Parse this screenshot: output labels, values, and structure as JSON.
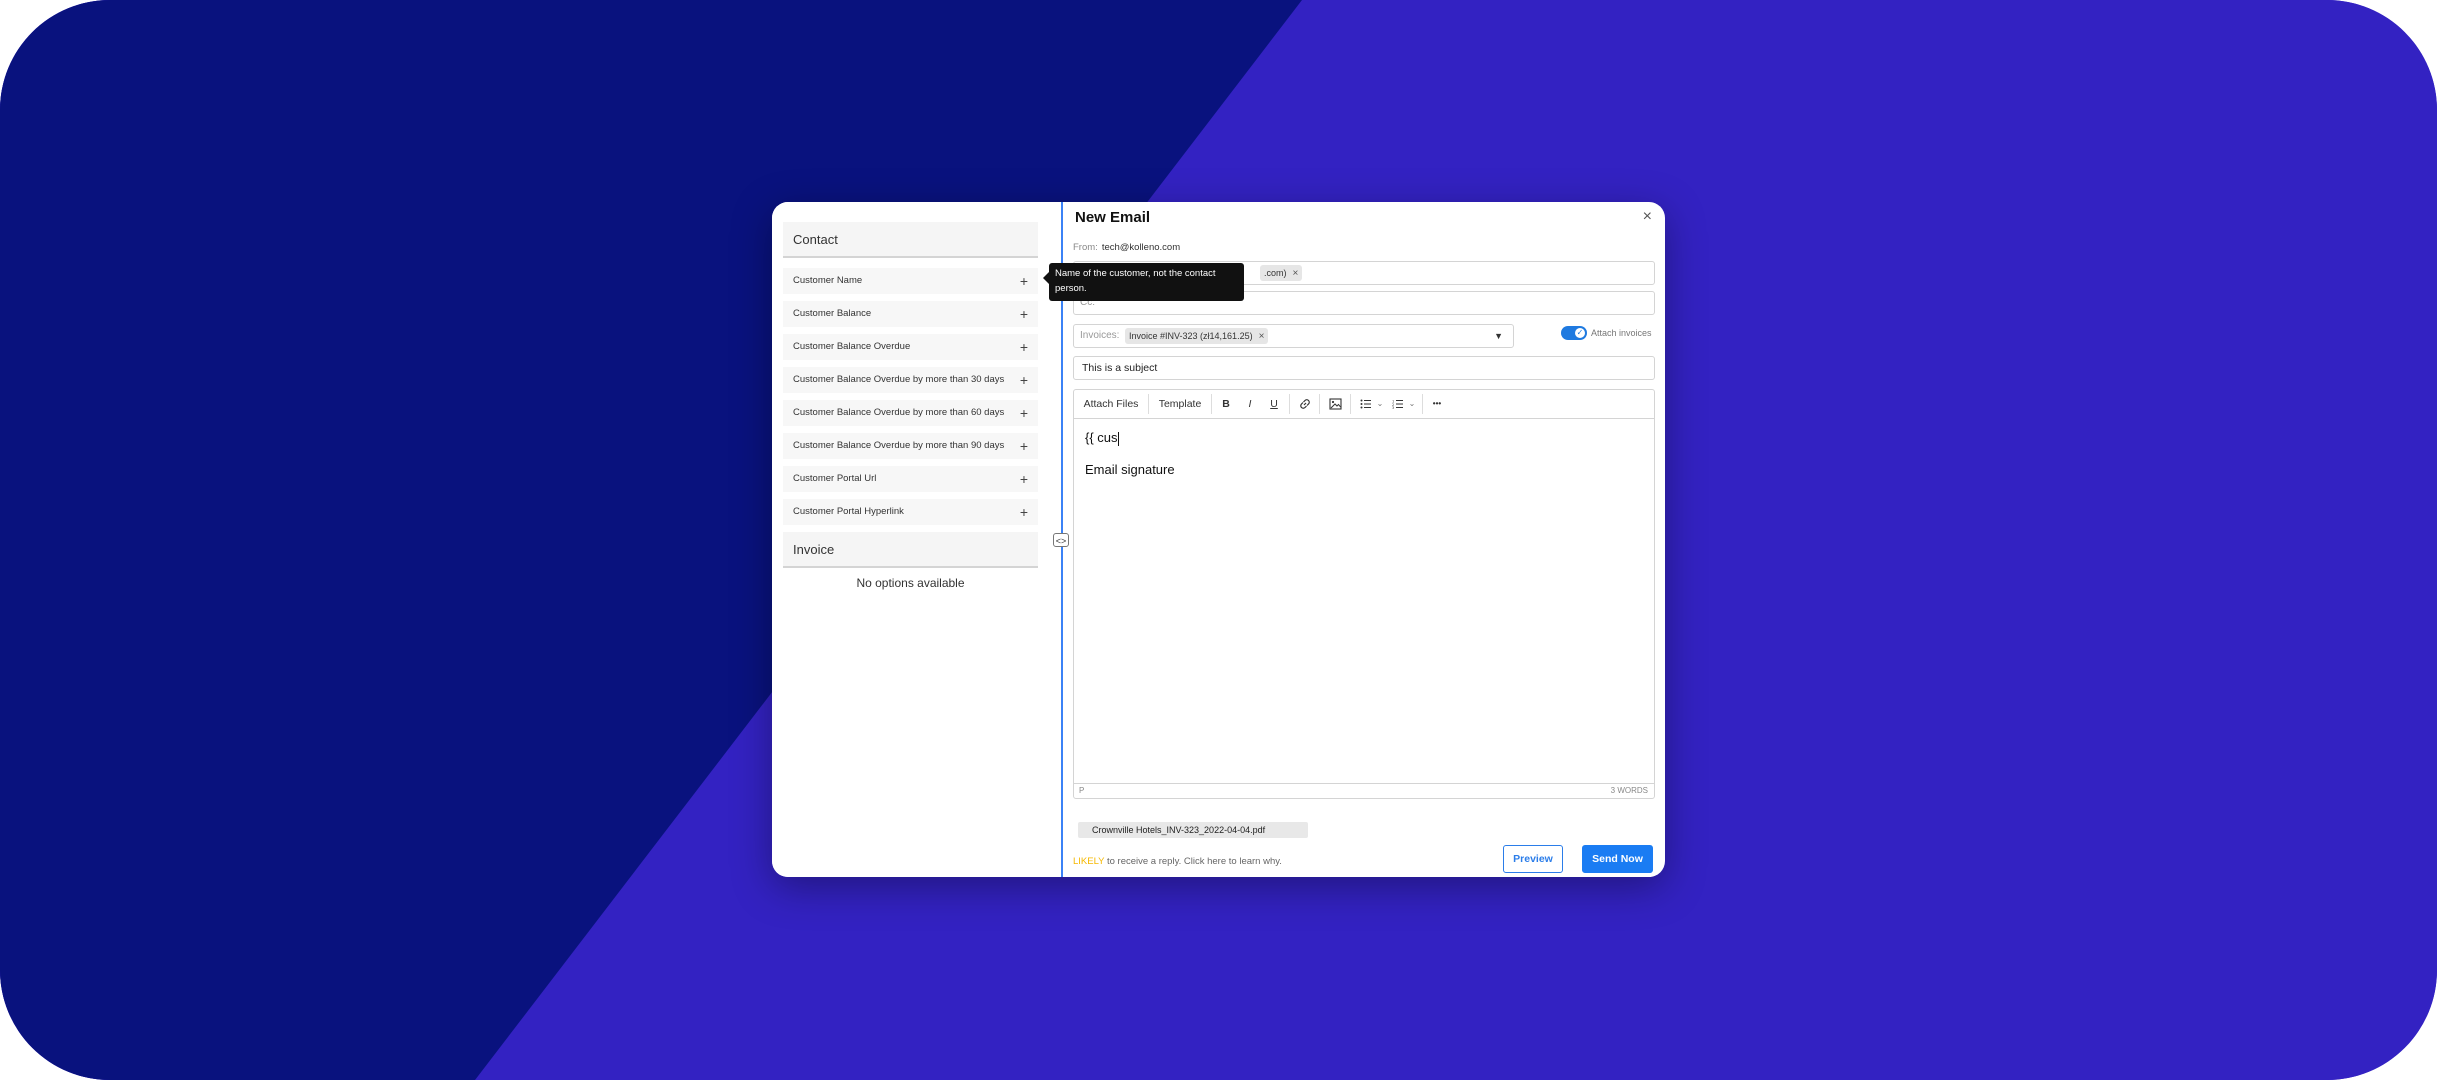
{
  "colors": {
    "background_dark": "#09127e",
    "background_light": "#3322c2",
    "accent": "#1a7cf3",
    "likely": "#f5b800"
  },
  "variables": {
    "sections": [
      {
        "title": "Contact",
        "items": [
          "Customer Name",
          "Customer Balance",
          "Customer Balance Overdue",
          "Customer Balance Overdue by more than 30 days",
          "Customer Balance Overdue by more than 60 days",
          "Customer Balance Overdue by more than 90 days",
          "Customer Portal Url",
          "Customer Portal Hyperlink"
        ]
      },
      {
        "title": "Invoice",
        "empty_text": "No options available"
      }
    ],
    "plus_glyph": "+",
    "tooltip": "Name of the customer, not the contact person."
  },
  "email": {
    "title": "New Email",
    "close_glyph": "×",
    "from_label": "From:",
    "from_value": "tech@kolleno.com",
    "to_chip": ".com)",
    "chip_remove": "×",
    "cc_label": "Cc:",
    "invoices_label": "Invoices:",
    "invoice_chip": "Invoice #INV-323 (zł14,161.25)",
    "attach_invoices_label": "Attach invoices",
    "attach_invoices_on": true,
    "subject": "This is a subject",
    "toolbar": {
      "attach_files": "Attach Files",
      "template": "Template",
      "bold": "B",
      "italic": "I",
      "underline": "U",
      "more": "•••"
    },
    "body_line1": "{{ cus",
    "body_line2": "Email signature",
    "status_path": "P",
    "word_count": "3 WORDS",
    "attachment_name": "Crownville Hotels_INV-323_2022-04-04.pdf",
    "likely_word": "LIKELY",
    "likely_rest": " to receive a reply. Click here to learn why.",
    "preview_button": "Preview",
    "send_button": "Send Now"
  }
}
